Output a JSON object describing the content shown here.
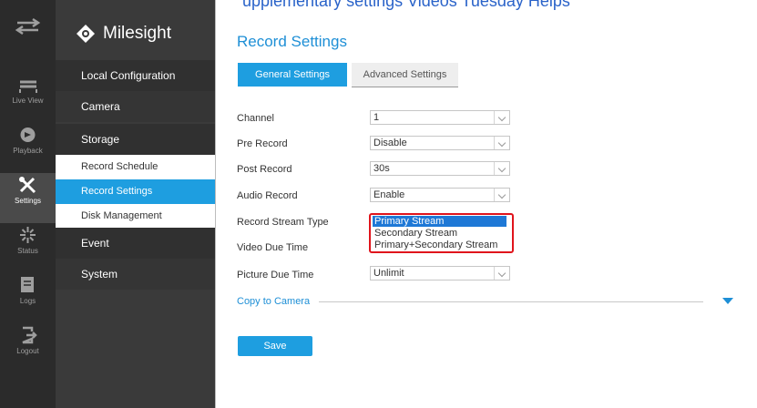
{
  "top_cut_text": "upplementary settings Videos  Tuesday  Helps",
  "rail": [
    {
      "label": "",
      "icon": "swap-icon"
    },
    {
      "label": "Live View",
      "icon": "live-view-icon"
    },
    {
      "label": "Playback",
      "icon": "playback-icon"
    },
    {
      "label": "Settings",
      "icon": "settings-icon"
    },
    {
      "label": "Status",
      "icon": "status-icon"
    },
    {
      "label": "Logs",
      "icon": "logs-icon"
    },
    {
      "label": "Logout",
      "icon": "logout-icon"
    }
  ],
  "brand": {
    "name": "Milesight"
  },
  "menu": {
    "local_configuration": "Local Configuration",
    "camera": "Camera",
    "storage": "Storage",
    "record_schedule": "Record Schedule",
    "record_settings": "Record Settings",
    "disk_management": "Disk Management",
    "event": "Event",
    "system": "System"
  },
  "page": {
    "title": "Record Settings",
    "tabs": {
      "general": "General Settings",
      "advanced": "Advanced Settings"
    }
  },
  "form": {
    "channel": {
      "label": "Channel",
      "value": "1"
    },
    "pre_record": {
      "label": "Pre Record",
      "value": "Disable"
    },
    "post_record": {
      "label": "Post Record",
      "value": "30s"
    },
    "audio_record": {
      "label": "Audio Record",
      "value": "Enable"
    },
    "record_stream_type": {
      "label": "Record Stream Type",
      "options": [
        "Primary Stream",
        "Secondary Stream",
        "Primary+Secondary Stream"
      ],
      "selected": "Primary Stream"
    },
    "video_due_time": {
      "label": "Video Due Time"
    },
    "picture_due_time": {
      "label": "Picture Due Time",
      "value": "Unlimit"
    }
  },
  "copy_to_camera": "Copy to Camera",
  "save_label": "Save",
  "colors": {
    "accent": "#1e9ee0",
    "highlight_border": "#e0141c",
    "sidebar": "#3a3a3a",
    "rail": "#2b2b2b"
  }
}
